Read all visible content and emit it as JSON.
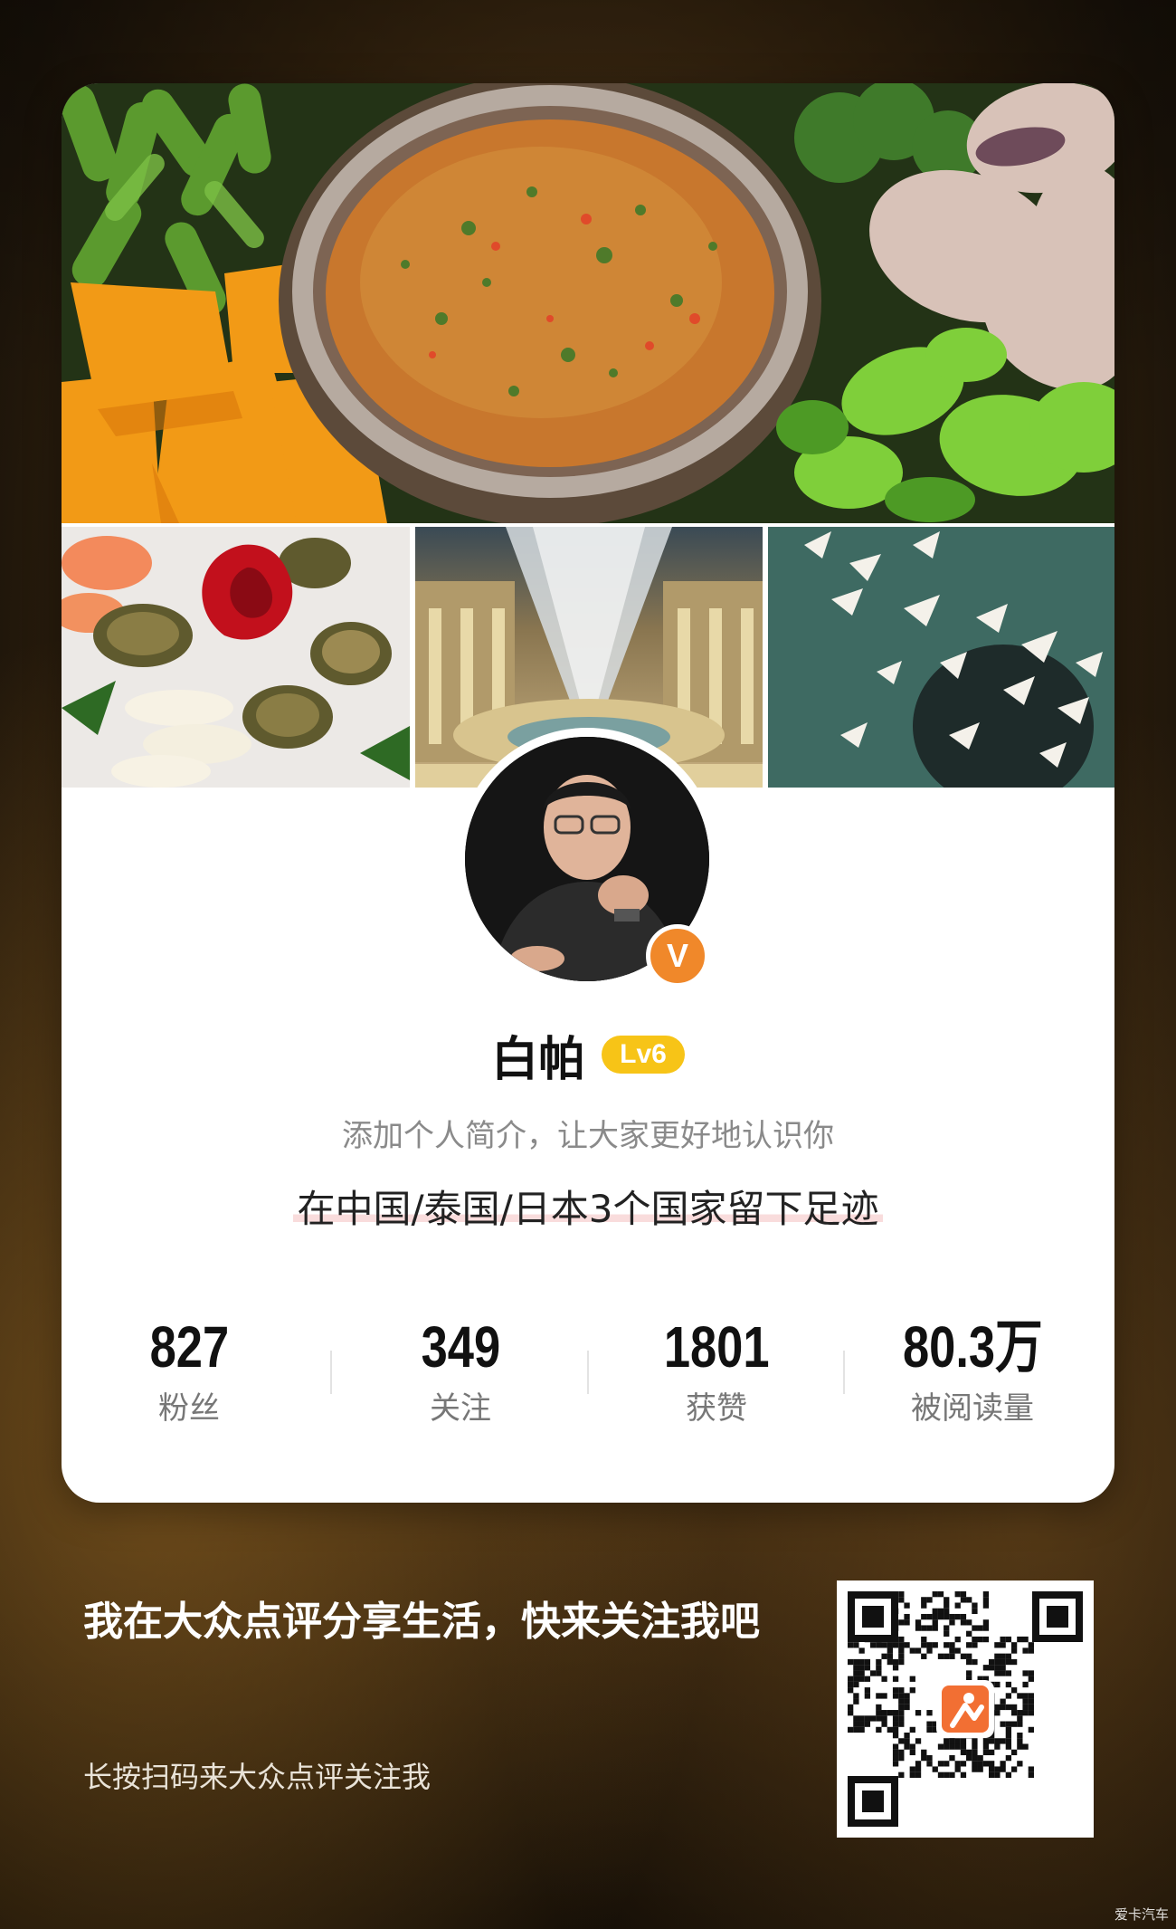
{
  "profile": {
    "name": "白帕",
    "level": "Lv6",
    "verified_mark": "V",
    "bio": "添加个人简介，让大家更好地认识你",
    "footprint": "在中国/泰国/日本3个国家留下足迹"
  },
  "stats": [
    {
      "value": "827",
      "label": "粉丝"
    },
    {
      "value": "349",
      "label": "关注"
    },
    {
      "value": "1801",
      "label": "获赞"
    },
    {
      "value": "80.3万",
      "label": "被阅读量"
    }
  ],
  "share": {
    "title": "我在大众点评分享生活，快来关注我吧",
    "subtitle": "长按扫码来大众点评关注我"
  },
  "watermark": "爱卡汽车",
  "colors": {
    "level_badge": "#f7c417",
    "verified_badge": "#f0882a",
    "qr_logo": "#f26f33"
  },
  "icons": {
    "verified": "v-badge-icon",
    "qr_logo": "dianping-logo-icon"
  }
}
